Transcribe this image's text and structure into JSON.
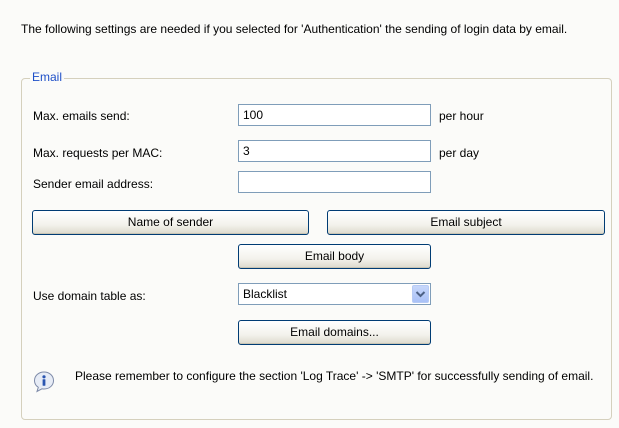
{
  "intro_text": "The following settings are needed if you selected for 'Authentication' the sending of login data by email.",
  "email_group": {
    "title": "Email",
    "max_emails_label": "Max. emails send:",
    "max_emails_value": "100",
    "max_emails_unit": "per hour",
    "max_requests_label": "Max. requests per MAC:",
    "max_requests_value": "3",
    "max_requests_unit": "per day",
    "sender_address_label": "Sender email address:",
    "sender_address_value": "",
    "name_of_sender_button": "Name of sender",
    "email_subject_button": "Email subject",
    "email_body_button": "Email body",
    "domain_table_label": "Use domain table as:",
    "domain_table_selected": "Blacklist",
    "email_domains_button": "Email domains...",
    "note_text": "Please remember to configure the section 'Log  Trace' -> 'SMTP' for successfully sending of email."
  },
  "icons": {
    "dropdown": "chevron-down-icon",
    "note": "info-icon"
  },
  "colors": {
    "group_title": "#1f50c8",
    "button_border": "#003c74",
    "input_border": "#7f9db9"
  }
}
